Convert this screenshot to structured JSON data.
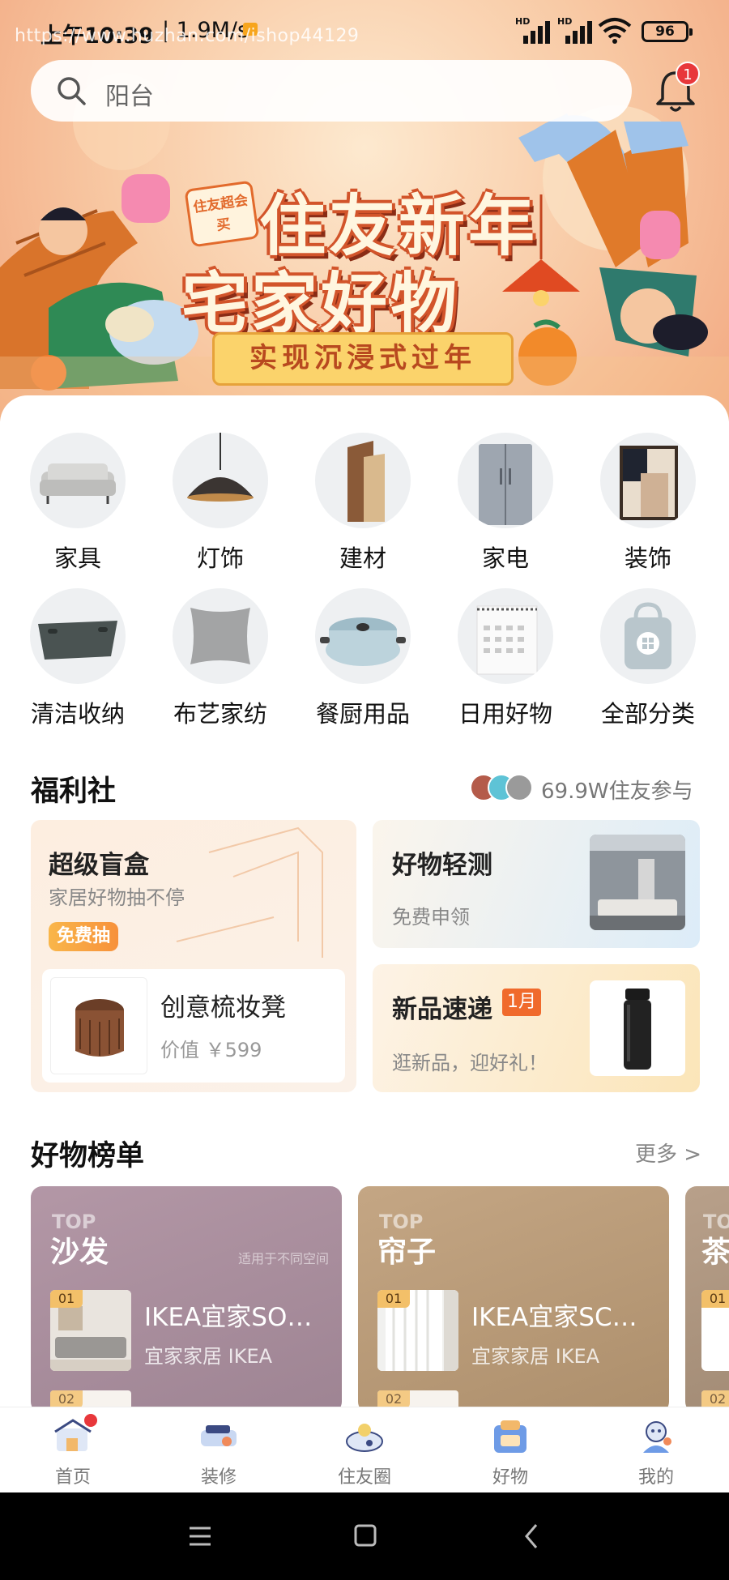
{
  "status_bar": {
    "time": "上午10:39",
    "speed": "| 1.9M/s",
    "watermark": "https://www.huzhan.com/ishop44129",
    "battery": "96"
  },
  "search": {
    "placeholder": "阳台",
    "notification_count": "1"
  },
  "banner": {
    "tag": "住友超会买",
    "title_line1": "住友新年",
    "title_line2": "宅家好物",
    "subtitle": "实现沉浸式过年"
  },
  "categories": [
    {
      "label": "家具",
      "icon": "sofa-icon"
    },
    {
      "label": "灯饰",
      "icon": "pendant-lamp-icon"
    },
    {
      "label": "建材",
      "icon": "wood-panel-icon"
    },
    {
      "label": "家电",
      "icon": "fridge-icon"
    },
    {
      "label": "装饰",
      "icon": "frame-icon"
    },
    {
      "label": "清洁收纳",
      "icon": "tray-icon"
    },
    {
      "label": "布艺家纺",
      "icon": "pillow-icon"
    },
    {
      "label": "餐厨用品",
      "icon": "pot-icon"
    },
    {
      "label": "日用好物",
      "icon": "calendar-icon"
    },
    {
      "label": "全部分类",
      "icon": "bag-grid-icon"
    }
  ],
  "welfare": {
    "title": "福利社",
    "participants": "69.9W住友参与",
    "blind_box": {
      "title": "超级盲盒",
      "subtitle": "家居好物抽不停",
      "badge": "免费抽",
      "product_name": "创意梳妆凳",
      "product_price": "价值 ￥599"
    },
    "trial": {
      "title": "好物轻测",
      "subtitle": "免费申领"
    },
    "new_arrivals": {
      "title": "新品速递",
      "badge": "1月",
      "subtitle": "逛新品，迎好礼！"
    }
  },
  "rankings": {
    "title": "好物榜单",
    "more": "更多 >",
    "cards": [
      {
        "top": "TOP",
        "category": "沙发",
        "note": "适用于不同空间",
        "rank": "01",
        "name": "IKEA宜家SO…",
        "brand": "宜家家居 IKEA",
        "next_rank": "02"
      },
      {
        "top": "TOP",
        "category": "帘子",
        "rank": "01",
        "name": "IKEA宜家SC…",
        "brand": "宜家家居 IKEA",
        "next_rank": "02"
      },
      {
        "top": "TO",
        "category": "茶",
        "rank": "01",
        "next_rank": "02"
      }
    ]
  },
  "tabs": [
    {
      "label": "首页",
      "icon": "home-icon"
    },
    {
      "label": "装修",
      "icon": "renovation-icon"
    },
    {
      "label": "住友圈",
      "icon": "community-icon"
    },
    {
      "label": "好物",
      "icon": "goods-icon"
    },
    {
      "label": "我的",
      "icon": "profile-icon"
    }
  ],
  "colors": {
    "accent": "#f07b2e",
    "badge_red": "#e8373b",
    "rank_card_1": "#a88a98",
    "rank_card_2": "#b39676"
  }
}
